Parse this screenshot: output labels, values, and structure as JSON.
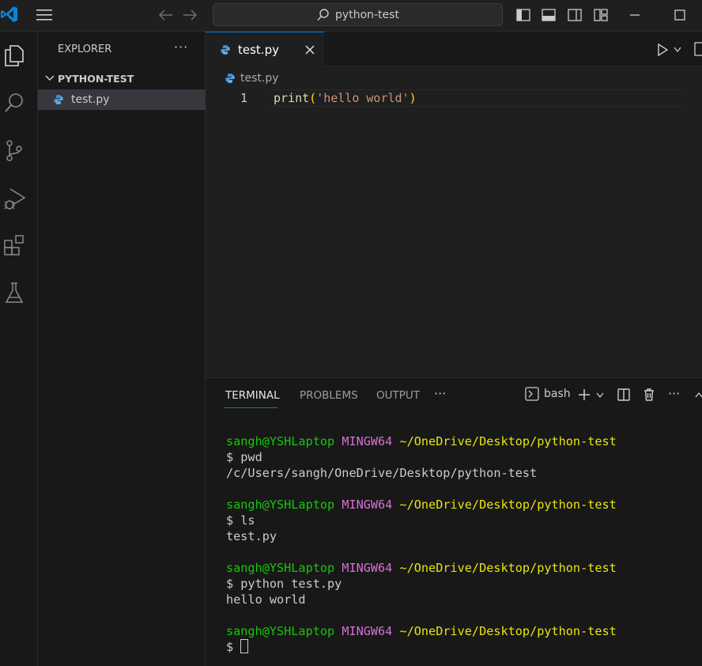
{
  "titlebar": {
    "search_text": "python-test"
  },
  "sidebar": {
    "title": "EXPLORER",
    "more": "···",
    "folder": "PYTHON-TEST",
    "file": "test.py"
  },
  "editor": {
    "tab_label": "test.py",
    "breadcrumb": "test.py",
    "line_number": "1",
    "code": {
      "fn": "print",
      "open": "(",
      "str": "'hello world'",
      "close": ")"
    }
  },
  "panel": {
    "tabs": [
      "TERMINAL",
      "PROBLEMS",
      "OUTPUT"
    ],
    "more": "···",
    "shell_label": "bash"
  },
  "terminal": {
    "prompt_user": "sangh@YSHLaptop",
    "prompt_host": "MINGW64",
    "prompt_path": "~/OneDrive/Desktop/python-test",
    "cmd1": "$ pwd",
    "out1": "/c/Users/sangh/OneDrive/Desktop/python-test",
    "cmd2": "$ ls",
    "out2": "test.py",
    "cmd3": "$ python test.py",
    "out3": "hello world",
    "cmd4": "$ "
  },
  "colors": {
    "accent": "#0078d4",
    "terminal_user": "#16c60c",
    "terminal_host": "#d670d6",
    "terminal_path": "#e5e510"
  }
}
